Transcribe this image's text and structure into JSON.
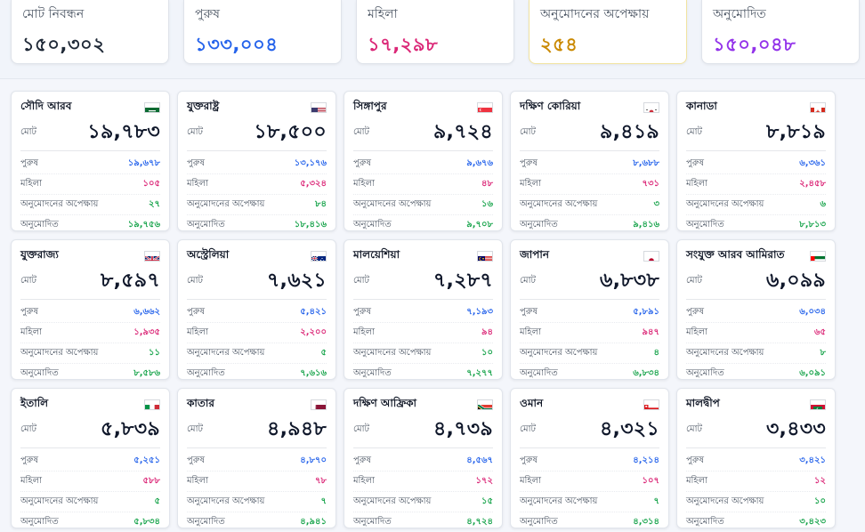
{
  "summary": [
    {
      "label": "মোট নিবন্ধন",
      "value": "১৫০,৩০২",
      "color": "#1f2937"
    },
    {
      "label": "পুরুষ",
      "value": "১৩৩,০০৪",
      "color": "#2563eb"
    },
    {
      "label": "মহিলা",
      "value": "১৭,২৯৮",
      "color": "#db2777"
    },
    {
      "label": "অনুমোদনের অপেক্ষায়",
      "value": "২৫৪",
      "color": "#ca8a04"
    },
    {
      "label": "অনুমোদিত",
      "value": "১৫০,০৪৮",
      "color": "#9333ea"
    }
  ],
  "labels": {
    "total": "মোট",
    "male": "পুরুষ",
    "female": "মহিলা",
    "pending": "অনুমোদনের অপেক্ষায়",
    "approved": "অনুমোদিত"
  },
  "countries": [
    {
      "name": "সৌদি আরব",
      "flag": "saudi-arabia-flag-icon",
      "total": "১৯,৭৮৩",
      "male": "১৯,৬৭৮",
      "female": "১০৫",
      "pending": "২৭",
      "approved": "১৯,৭৫৬"
    },
    {
      "name": "যুক্তরাষ্ট্র",
      "flag": "usa-flag-icon",
      "total": "১৮,৫০০",
      "male": "১৩,১৭৬",
      "female": "৫,৩২৪",
      "pending": "৮৪",
      "approved": "১৮,৪১৬"
    },
    {
      "name": "সিঙ্গাপুর",
      "flag": "singapore-flag-icon",
      "total": "৯,৭২৪",
      "male": "৯,৬৭৬",
      "female": "৪৮",
      "pending": "১৬",
      "approved": "৯,৭০৮"
    },
    {
      "name": "দক্ষিণ কোরিয়া",
      "flag": "south-korea-flag-icon",
      "total": "৯,৪১৯",
      "male": "৮,৬৮৮",
      "female": "৭৩১",
      "pending": "৩",
      "approved": "৯,৪১৬"
    },
    {
      "name": "কানাডা",
      "flag": "canada-flag-icon",
      "total": "৮,৮১৯",
      "male": "৬,৩৬১",
      "female": "২,৪৫৮",
      "pending": "৬",
      "approved": "৮,৮১৩"
    },
    {
      "name": "যুক্তরাজ্য",
      "flag": "uk-flag-icon",
      "total": "৮,৫৯৭",
      "male": "৬,৬৬২",
      "female": "১,৯৩৫",
      "pending": "১১",
      "approved": "৮,৫৮৬"
    },
    {
      "name": "অস্ট্রেলিয়া",
      "flag": "australia-flag-icon",
      "total": "৭,৬২১",
      "male": "৫,৪২১",
      "female": "২,২০০",
      "pending": "৫",
      "approved": "৭,৬১৬"
    },
    {
      "name": "মালয়েশিয়া",
      "flag": "malaysia-flag-icon",
      "total": "৭,২৮৭",
      "male": "৭,১৯৩",
      "female": "৯৪",
      "pending": "১০",
      "approved": "৭,২৭৭"
    },
    {
      "name": "জাপান",
      "flag": "japan-flag-icon",
      "total": "৬,৮৩৮",
      "male": "৫,৮৯১",
      "female": "৯৪৭",
      "pending": "৪",
      "approved": "৬,৮৩৪"
    },
    {
      "name": "সংযুক্ত আরব আমিরাত",
      "flag": "uae-flag-icon",
      "total": "৬,০৯৯",
      "male": "৬,০৩৪",
      "female": "৬৫",
      "pending": "৮",
      "approved": "৬,০৯১"
    },
    {
      "name": "ইতালি",
      "flag": "italy-flag-icon",
      "total": "৫,৮৩৯",
      "male": "৫,২৫১",
      "female": "৫৮৮",
      "pending": "৫",
      "approved": "৫,৮৩৪"
    },
    {
      "name": "কাতার",
      "flag": "qatar-flag-icon",
      "total": "৪,৯৪৮",
      "male": "৪,৮৭০",
      "female": "৭৮",
      "pending": "৭",
      "approved": "৪,৯৪১"
    },
    {
      "name": "দক্ষিণ আফ্রিকা",
      "flag": "south-africa-flag-icon",
      "total": "৪,৭৩৯",
      "male": "৪,৫৬৭",
      "female": "১৭২",
      "pending": "১৫",
      "approved": "৪,৭২৪"
    },
    {
      "name": "ওমান",
      "flag": "oman-flag-icon",
      "total": "৪,৩২১",
      "male": "৪,২১৪",
      "female": "১০৭",
      "pending": "৭",
      "approved": "৪,৩১৪"
    },
    {
      "name": "মালদ্বীপ",
      "flag": "maldives-flag-icon",
      "total": "৩,৪৩৩",
      "male": "৩,৪২১",
      "female": "১২",
      "pending": "১০",
      "approved": "৩,৪২৩"
    }
  ]
}
